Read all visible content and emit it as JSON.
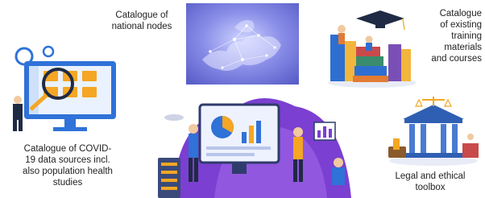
{
  "panels": [
    {
      "id": "national_nodes",
      "label": "Catalogue of national nodes"
    },
    {
      "id": "training",
      "label_lines": [
        "Catalogue",
        "of existing",
        "training",
        "materials",
        "and courses"
      ]
    },
    {
      "id": "covid",
      "label_lines": [
        "Catalogue of COVID-",
        "19 data sources incl.",
        "also population health",
        "studies"
      ]
    },
    {
      "id": "legal",
      "label_lines": [
        "Legal and ethical",
        "toolbox"
      ]
    }
  ],
  "colors": {
    "europe_map_bg": "#6a6fd6",
    "monitor_blue": "#2f72d8",
    "accent_orange": "#f5a623",
    "purple_backdrop": "#7b3fd1",
    "legal_building": "#2f5fb3"
  },
  "icons": [
    "europe-network-map",
    "books-graduation-cap-illustration",
    "data-catalogue-monitor-illustration",
    "data-team-dashboard-illustration",
    "justice-scales-illustration"
  ]
}
